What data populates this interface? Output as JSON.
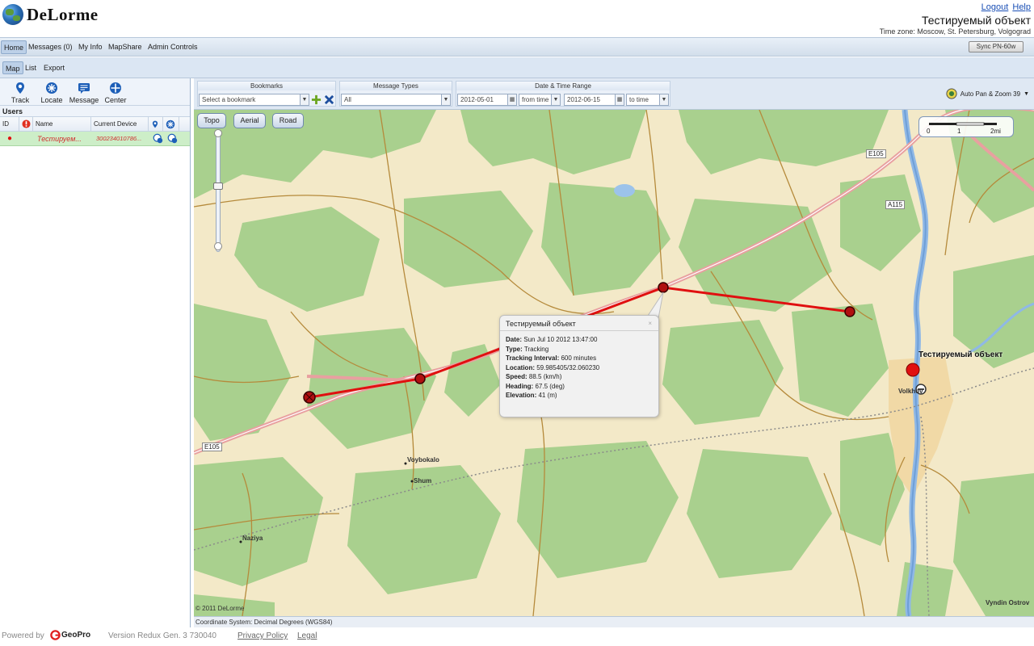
{
  "header": {
    "logo_text": "DeLorme",
    "logout_label": "Logout",
    "help_label": "Help",
    "object_title": "Тестируемый объект",
    "timezone": "Time zone: Moscow, St. Petersburg, Volgograd"
  },
  "nav": {
    "items": [
      "Home",
      "Messages (0)",
      "My Info",
      "MapShare",
      "Admin Controls"
    ],
    "sync_label": "Sync PN-60w"
  },
  "subnav": {
    "items": [
      "Map",
      "List",
      "Export"
    ]
  },
  "toolbar": {
    "track": "Track",
    "locate": "Locate",
    "message": "Message",
    "center": "Center"
  },
  "users": {
    "label": "Users",
    "columns": [
      "ID",
      "Name",
      "Current Device"
    ],
    "row": {
      "name": "Тестируем...",
      "device": "300234010786..."
    }
  },
  "filters": {
    "bookmarks_title": "Bookmarks",
    "bookmarks_placeholder": "Select a bookmark",
    "message_types_title": "Message Types",
    "message_types_value": "All",
    "date_range_title": "Date & Time Range",
    "start_date": "2012-05-01",
    "from_time": "from time",
    "end_date": "2012-06-15",
    "to_time": "to time",
    "autopan": "Auto Pan & Zoom 39"
  },
  "map": {
    "buttons": [
      "Topo",
      "Aerial",
      "Road"
    ],
    "scale_labels": [
      "0",
      "1",
      "2mi"
    ],
    "copyright": "© 2011 DeLorme",
    "labels": {
      "e105_a": "E105",
      "e105_b": "E105",
      "a115": "A115",
      "voybokalo": "Voybokalo",
      "shum": "Shum",
      "naziya": "Naziya",
      "volkhov": "Volkhov",
      "vyndin": "Vyndin Ostrov",
      "object": "Тестируемый объект"
    },
    "coord_system": "Coordinate System: Decimal Degrees (WGS84)"
  },
  "popup": {
    "title": "Тестируемый объект",
    "close": "×",
    "date_label": "Date:",
    "date_value": "Sun Jul  10 2012 13:47:00",
    "type_label": "Type:",
    "type_value": "Tracking",
    "interval_label": "Tracking Interval:",
    "interval_value": "600 minutes",
    "location_label": "Location:",
    "location_value": "59.985405/32.060230",
    "speed_label": "Speed:",
    "speed_value": "88.5 (km/h)",
    "heading_label": "Heading:",
    "heading_value": "67.5 (deg)",
    "elevation_label": "Elevation:",
    "elevation_value": "41 (m)"
  },
  "footer": {
    "powered_by": "Powered by",
    "geopro": "GeoPro",
    "version": "Version Redux Gen. 3 730040",
    "privacy": "Privacy Policy",
    "legal": "Legal"
  },
  "colors": {
    "track_red": "#e01010",
    "forest_green": "#a9d08e",
    "terrain_tan": "#f3e9c8",
    "river_blue": "#8fb8e6"
  }
}
